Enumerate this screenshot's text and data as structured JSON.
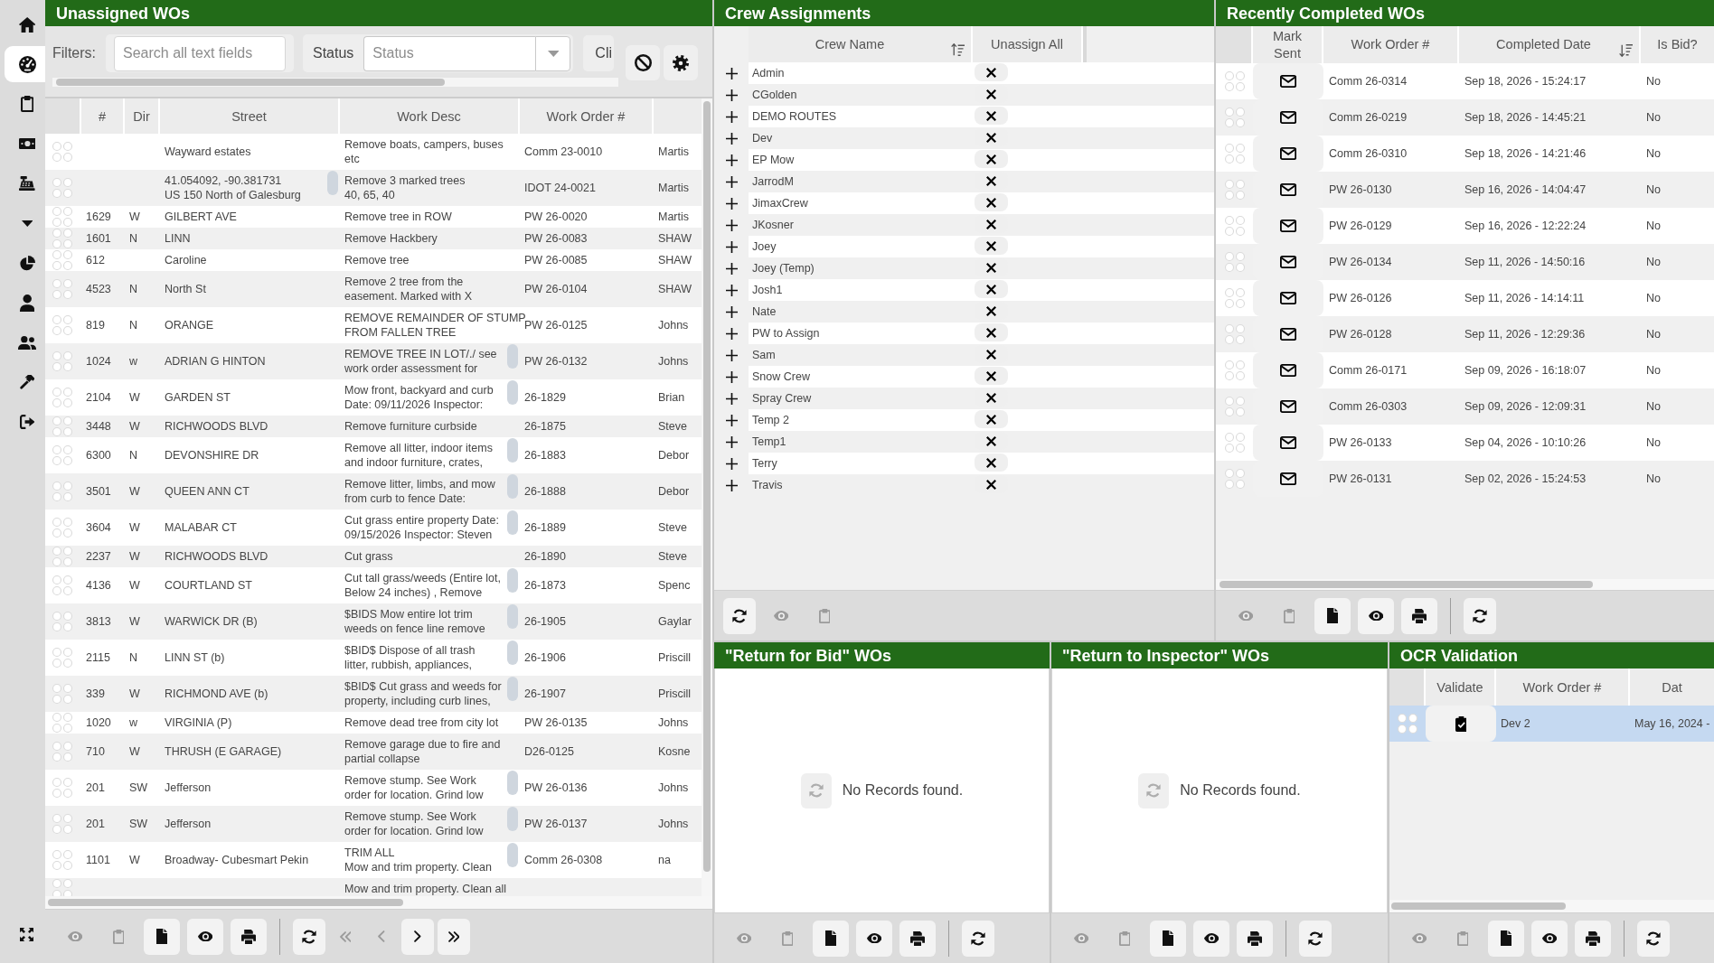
{
  "sidebar": {
    "items": [
      {
        "selected": false
      },
      {
        "selected": true
      },
      {
        "selected": false
      },
      {
        "selected": false
      },
      {
        "selected": false
      },
      {
        "selected": false
      },
      {
        "selected": false
      },
      {
        "selected": false
      },
      {
        "selected": false
      },
      {
        "selected": false
      },
      {
        "selected": false
      }
    ]
  },
  "unassigned": {
    "title": "Unassigned WOs",
    "filters": {
      "label": "Filters:",
      "search": {
        "placeholder": "Search all text fields"
      },
      "status": {
        "label": "Status",
        "placeholder": "Status"
      },
      "partial_button": "Cli"
    },
    "columns": [
      "#",
      "Dir",
      "Street",
      "Work Desc",
      "Work Order #"
    ],
    "rows": [
      {
        "street": "Wayward estates",
        "desc": "Remove boats, campers, buses\netc",
        "work_order": "Comm 23-0010",
        "column_6": "Martis",
        "street_scroll": false,
        "desc_scroll": false,
        "selected": false
      },
      {
        "street": "41.054092, -90.381731\nUS 150 North of Galesburg",
        "desc": "Remove 3 marked trees\n40, 65, 40",
        "work_order": "IDOT 24-0021",
        "column_6": "Martis",
        "street_scroll": true,
        "desc_scroll": false,
        "selected": false
      },
      {
        "number": "1629",
        "dir": "W",
        "street": "GILBERT AVE",
        "desc": "Remove tree in ROW",
        "work_order": "PW 26-0020",
        "column_6": "Martis",
        "street_scroll": false,
        "desc_scroll": false,
        "selected": false
      },
      {
        "number": "1601",
        "dir": "N",
        "street": "LINN",
        "desc": "Remove Hackbery",
        "work_order": "PW 26-0083",
        "column_6": "SHAW",
        "street_scroll": false,
        "desc_scroll": false,
        "selected": false
      },
      {
        "number": "612",
        "street": "Caroline",
        "desc": "Remove tree",
        "work_order": "PW 26-0085",
        "column_6": "SHAW",
        "street_scroll": false,
        "desc_scroll": false,
        "selected": false
      },
      {
        "number": "4523",
        "dir": "N",
        "street": "North St",
        "desc": "Remove 2 tree from the\neasement. Marked with X",
        "work_order": "PW 26-0104",
        "column_6": "SHAW",
        "street_scroll": false,
        "desc_scroll": false,
        "selected": false
      },
      {
        "number": "819",
        "dir": "N",
        "street": "ORANGE",
        "desc": "REMOVE REMAINDER OF STUMP\nFROM FALLEN TREE",
        "work_order": "PW 26-0125",
        "column_6": "Johns",
        "street_scroll": false,
        "desc_scroll": false,
        "selected": false
      },
      {
        "number": "1024",
        "dir": "w",
        "street": "ADRIAN G HINTON",
        "desc": "REMOVE TREE IN LOT/./ see\nwork order assessment for",
        "work_order": "PW 26-0132",
        "column_6": "Johns",
        "street_scroll": false,
        "desc_scroll": true,
        "selected": false
      },
      {
        "number": "2104",
        "dir": "W",
        "street": "GARDEN ST",
        "desc": "Mow front, backyard and curb\nDate: 09/11/2026 Inspector:",
        "work_order": "26-1829",
        "column_6": "Brian",
        "street_scroll": false,
        "desc_scroll": true,
        "selected": false
      },
      {
        "number": "3448",
        "dir": "W",
        "street": "RICHWOODS BLVD",
        "desc": "Remove furniture curbside",
        "work_order": "26-1875",
        "column_6": "Steve",
        "street_scroll": false,
        "desc_scroll": false,
        "selected": false
      },
      {
        "number": "6300",
        "dir": "N",
        "street": "DEVONSHIRE DR",
        "desc": "Remove all litter, indoor items\nand indoor furniture, crates,",
        "work_order": "26-1883",
        "column_6": "Debor",
        "street_scroll": false,
        "desc_scroll": true,
        "selected": false
      },
      {
        "number": "3501",
        "dir": "W",
        "street": "QUEEN ANN CT",
        "desc": "Remove litter, limbs, and mow\nfrom curb to fence Date:",
        "work_order": "26-1888",
        "column_6": "Debor",
        "street_scroll": false,
        "desc_scroll": true,
        "selected": false
      },
      {
        "number": "3604",
        "dir": "W",
        "street": "MALABAR CT",
        "desc": "Cut grass entire property Date:\n09/15/2026 Inspector: Steven",
        "work_order": "26-1889",
        "column_6": "Steve",
        "street_scroll": false,
        "desc_scroll": true,
        "selected": false
      },
      {
        "number": "2237",
        "dir": "W",
        "street": "RICHWOODS BLVD",
        "desc": "Cut grass",
        "work_order": "26-1890",
        "column_6": "Steve",
        "street_scroll": false,
        "desc_scroll": false,
        "selected": false
      },
      {
        "number": "4136",
        "dir": "W",
        "street": "COURTLAND ST",
        "desc": "Cut tall grass/weeds (Entire lot,\nBelow 24 inches) , Remove",
        "work_order": "26-1873",
        "column_6": "Spenc",
        "street_scroll": false,
        "desc_scroll": true,
        "selected": false
      },
      {
        "number": "3813",
        "dir": "W",
        "street": "WARWICK DR (B)",
        "desc": "$BIDS Mow entire lot trim\nweeds on fence line remove",
        "work_order": "26-1905",
        "column_6": "Gaylar",
        "street_scroll": false,
        "desc_scroll": true,
        "selected": false
      },
      {
        "number": "2115",
        "dir": "N",
        "street": "LINN ST (b)",
        "desc": "$BID$ Dispose of all trash\nlitter, rubbish, appliances,",
        "work_order": "26-1906",
        "column_6": "Priscill",
        "street_scroll": false,
        "desc_scroll": true,
        "selected": false
      },
      {
        "number": "339",
        "dir": "W",
        "street": "RICHMOND AVE (b)",
        "desc": "$BID$ Cut grass and weeds for\nproperty, including curb lines,",
        "work_order": "26-1907",
        "column_6": "Priscill",
        "street_scroll": false,
        "desc_scroll": true,
        "selected": false
      },
      {
        "number": "1020",
        "dir": "w",
        "street": "VIRGINIA (P)",
        "desc": "Remove dead tree from city lot",
        "work_order": "PW 26-0135",
        "column_6": "Johns",
        "street_scroll": false,
        "desc_scroll": false,
        "selected": false
      },
      {
        "number": "710",
        "dir": "W",
        "street": "THRUSH (E GARAGE)",
        "desc": "Remove garage due to fire and\npartial collapse",
        "work_order": "D26-0125",
        "column_6": "Kosne",
        "street_scroll": false,
        "desc_scroll": false,
        "selected": false
      },
      {
        "number": "201",
        "dir": "SW",
        "street": "Jefferson",
        "desc": "Remove stump. See Work\norder for location. Grind low",
        "work_order": "PW 26-0136",
        "column_6": "Johns",
        "street_scroll": false,
        "desc_scroll": true,
        "selected": false
      },
      {
        "number": "201",
        "dir": "SW",
        "street": "Jefferson",
        "desc": "Remove stump. See Work\norder for location. Grind low",
        "work_order": "PW 26-0137",
        "column_6": "Johns",
        "street_scroll": false,
        "desc_scroll": true,
        "selected": false
      },
      {
        "number": "1101",
        "dir": "W",
        "street": "Broadway- Cubesmart Pekin",
        "desc": "TRIM ALL\nMow and trim property. Clean",
        "work_order": "Comm 26-0308",
        "column_6": "na",
        "street_scroll": false,
        "desc_scroll": true,
        "selected": false
      },
      {
        "desc": "Mow and trim property. Clean all",
        "street_scroll": false,
        "desc_scroll": false,
        "selected": false
      }
    ],
    "toolbar": [
      {
        "kind": "view",
        "disabled": true
      },
      {
        "kind": "copy",
        "disabled": true
      },
      {
        "kind": "pdf",
        "disabled": false
      },
      {
        "kind": "view",
        "disabled": false
      },
      {
        "kind": "print",
        "disabled": false
      },
      {
        "kind": "separator"
      },
      {
        "kind": "refresh",
        "disabled": false
      },
      {
        "kind": "first",
        "disabled": true
      },
      {
        "kind": "prev",
        "disabled": true
      },
      {
        "kind": "next",
        "disabled": false
      },
      {
        "kind": "last",
        "disabled": false
      }
    ]
  },
  "crew": {
    "title": "Crew Assignments",
    "columns": [
      {
        "label": "Crew Name",
        "sort_ascending": true
      },
      {
        "label": "Unassign All",
        "sort_ascending": false
      }
    ],
    "rows": [
      {
        "name": "Admin",
        "selected": false
      },
      {
        "name": "CGolden",
        "selected": false
      },
      {
        "name": "DEMO ROUTES",
        "selected": false
      },
      {
        "name": "Dev",
        "selected": false
      },
      {
        "name": "EP Mow",
        "selected": false
      },
      {
        "name": "JarrodM",
        "selected": false
      },
      {
        "name": "JimaxCrew",
        "selected": false
      },
      {
        "name": "JKosner",
        "selected": false
      },
      {
        "name": "Joey",
        "selected": false
      },
      {
        "name": "Joey (Temp)",
        "selected": false
      },
      {
        "name": "Josh1",
        "selected": false
      },
      {
        "name": "Nate",
        "selected": false
      },
      {
        "name": "PW to Assign",
        "selected": false
      },
      {
        "name": "Sam",
        "selected": false
      },
      {
        "name": "Snow Crew",
        "selected": false
      },
      {
        "name": "Spray Crew",
        "selected": false
      },
      {
        "name": "Temp 2",
        "selected": false
      },
      {
        "name": "Temp1",
        "selected": false
      },
      {
        "name": "Terry",
        "selected": false
      },
      {
        "name": "Travis",
        "selected": false
      }
    ],
    "toolbar": [
      {
        "kind": "refresh",
        "disabled": false
      },
      {
        "kind": "view",
        "disabled": true
      },
      {
        "kind": "copy",
        "disabled": true
      }
    ]
  },
  "recent": {
    "title": "Recently Completed WOs",
    "columns": [
      {
        "label": "Mark Sent",
        "sort_descending": false
      },
      {
        "label": "Work Order #",
        "sort_descending": false
      },
      {
        "label": "Completed Date",
        "sort_descending": true
      },
      {
        "label": "Is Bid?",
        "sort_descending": false
      }
    ],
    "rows": [
      {
        "work_order": "Comm 26-0314",
        "completed": "Sep 18, 2026 - 15:24:17",
        "is_bid": "No",
        "selected": false
      },
      {
        "work_order": "Comm 26-0219",
        "completed": "Sep 18, 2026 - 14:45:21",
        "is_bid": "No",
        "selected": false
      },
      {
        "work_order": "Comm 26-0310",
        "completed": "Sep 18, 2026 - 14:21:46",
        "is_bid": "No",
        "selected": false
      },
      {
        "work_order": "PW 26-0130",
        "completed": "Sep 16, 2026 - 14:04:47",
        "is_bid": "No",
        "selected": false
      },
      {
        "work_order": "PW 26-0129",
        "completed": "Sep 16, 2026 - 12:22:24",
        "is_bid": "No",
        "selected": false
      },
      {
        "work_order": "PW 26-0134",
        "completed": "Sep 11, 2026 - 14:50:16",
        "is_bid": "No",
        "selected": false
      },
      {
        "work_order": "PW 26-0126",
        "completed": "Sep 11, 2026 - 14:14:11",
        "is_bid": "No",
        "selected": false
      },
      {
        "work_order": "PW 26-0128",
        "completed": "Sep 11, 2026 - 12:29:36",
        "is_bid": "No",
        "selected": false
      },
      {
        "work_order": "Comm 26-0171",
        "completed": "Sep 09, 2026 - 16:18:07",
        "is_bid": "No",
        "selected": false
      },
      {
        "work_order": "Comm 26-0303",
        "completed": "Sep 09, 2026 - 12:09:31",
        "is_bid": "No",
        "selected": false
      },
      {
        "work_order": "PW 26-0133",
        "completed": "Sep 04, 2026 - 10:10:26",
        "is_bid": "No",
        "selected": false
      },
      {
        "work_order": "PW 26-0131",
        "completed": "Sep 02, 2026 - 15:24:53",
        "is_bid": "No",
        "selected": false
      }
    ],
    "toolbar": [
      {
        "kind": "view",
        "disabled": true
      },
      {
        "kind": "copy",
        "disabled": true
      },
      {
        "kind": "pdf",
        "disabled": false
      },
      {
        "kind": "view",
        "disabled": false
      },
      {
        "kind": "print",
        "disabled": false
      },
      {
        "kind": "separator"
      },
      {
        "kind": "refresh",
        "disabled": false
      }
    ]
  },
  "return_for_bid": {
    "title": "\"Return for Bid\" WOs",
    "message": "No Records found.",
    "toolbar": [
      {
        "kind": "view",
        "disabled": true
      },
      {
        "kind": "copy",
        "disabled": true
      },
      {
        "kind": "pdf",
        "disabled": false
      },
      {
        "kind": "view",
        "disabled": false
      },
      {
        "kind": "print",
        "disabled": false
      },
      {
        "kind": "separator"
      },
      {
        "kind": "refresh",
        "disabled": false
      }
    ]
  },
  "return_to_inspector": {
    "title": "\"Return to Inspector\" WOs",
    "message": "No Records found.",
    "toolbar": [
      {
        "kind": "view",
        "disabled": true
      },
      {
        "kind": "copy",
        "disabled": true
      },
      {
        "kind": "pdf",
        "disabled": false
      },
      {
        "kind": "view",
        "disabled": false
      },
      {
        "kind": "print",
        "disabled": false
      },
      {
        "kind": "separator"
      },
      {
        "kind": "refresh",
        "disabled": false
      }
    ]
  },
  "ocr": {
    "title": "OCR Validation",
    "columns": [
      {
        "label": "Validate"
      },
      {
        "label": "Work Order #"
      },
      {
        "label": "Dat"
      }
    ],
    "rows": [
      {
        "work_order": "Dev 2",
        "date": "May 16, 2024 -",
        "selected": true
      }
    ],
    "toolbar": [
      {
        "kind": "view",
        "disabled": true
      },
      {
        "kind": "copy",
        "disabled": true
      },
      {
        "kind": "pdf",
        "disabled": false
      },
      {
        "kind": "view",
        "disabled": false
      },
      {
        "kind": "print",
        "disabled": false
      },
      {
        "kind": "separator"
      },
      {
        "kind": "refresh",
        "disabled": false
      }
    ]
  }
}
